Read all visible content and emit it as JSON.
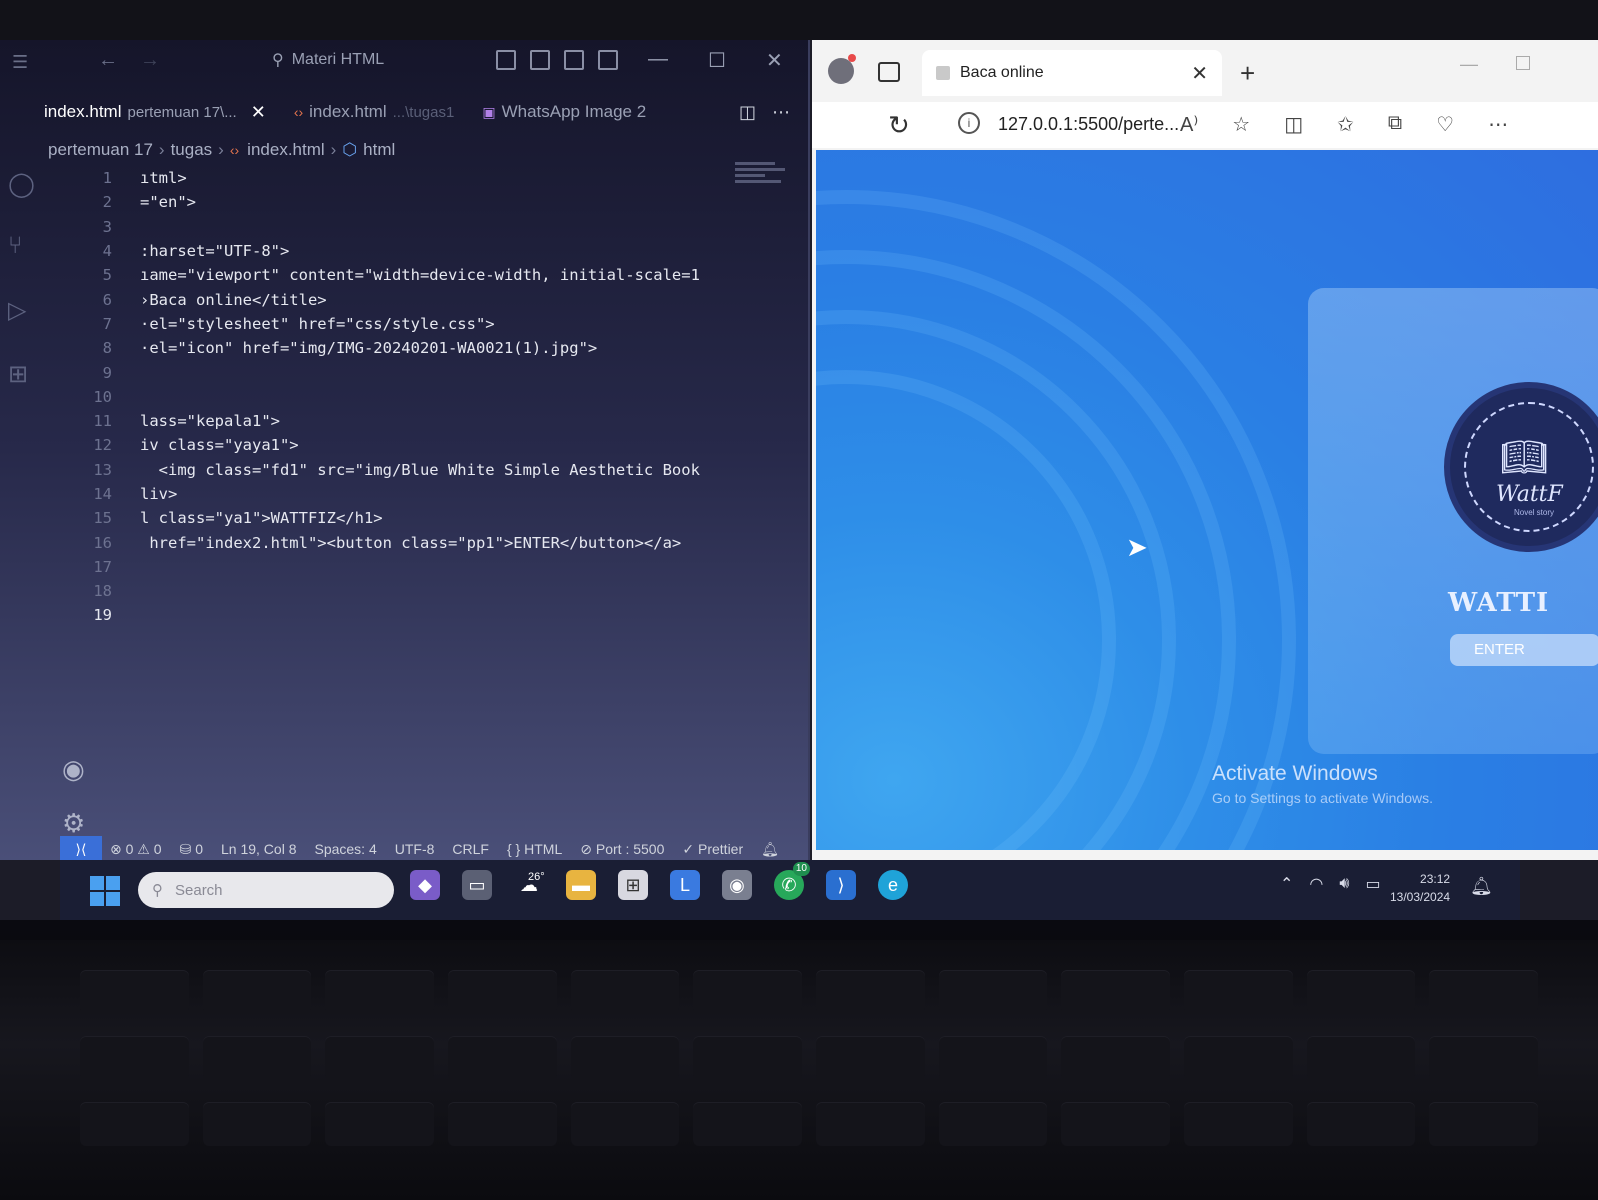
{
  "vscode": {
    "title": "Materi HTML",
    "tabs": [
      {
        "label": "index.html",
        "sublabel": "pertemuan 17\\...",
        "active": true
      },
      {
        "label": "index.html",
        "sublabel": "...\\tugas1",
        "active": false
      },
      {
        "label": "WhatsApp Image 2",
        "sublabel": "",
        "active": false
      }
    ],
    "breadcrumb": [
      "pertemuan 17",
      "tugas",
      "index.html",
      "html"
    ],
    "code_lines": [
      {
        "n": "1",
        "text": "ıtml>"
      },
      {
        "n": "2",
        "text": "=\"en\">"
      },
      {
        "n": "3",
        "text": ""
      },
      {
        "n": "4",
        "text": ":harset=\"UTF-8\">"
      },
      {
        "n": "5",
        "text": "ıame=\"viewport\" content=\"width=device-width, initial-scale=1"
      },
      {
        "n": "6",
        "text": "›Baca online</title>"
      },
      {
        "n": "7",
        "text": "·el=\"stylesheet\" href=\"css/style.css\">"
      },
      {
        "n": "8",
        "text": "·el=\"icon\" href=\"img/IMG-20240201-WA0021(1).jpg\">"
      },
      {
        "n": "9",
        "text": ""
      },
      {
        "n": "10",
        "text": ""
      },
      {
        "n": "11",
        "text": "lass=\"kepala1\">"
      },
      {
        "n": "12",
        "text": "iv class=\"yaya1\">"
      },
      {
        "n": "13",
        "text": "  <img class=\"fd1\" src=\"img/Blue White Simple Aesthetic Book"
      },
      {
        "n": "14",
        "text": "liv>"
      },
      {
        "n": "15",
        "text": "l class=\"ya1\">WATTFIZ</h1>"
      },
      {
        "n": "16",
        "text": " href=\"index2.html\"><button class=\"pp1\">ENTER</button></a>"
      },
      {
        "n": "17",
        "text": ""
      },
      {
        "n": "18",
        "text": ""
      },
      {
        "n": "19",
        "text": ""
      }
    ],
    "status": {
      "errors": "0",
      "warnings": "0",
      "ports": "0",
      "position": "Ln 19, Col 8",
      "spaces": "Spaces: 4",
      "encoding": "UTF-8",
      "eol": "CRLF",
      "language": "HTML",
      "port": "Port : 5500",
      "formatter": "Prettier"
    }
  },
  "browser": {
    "tab_title": "Baca online",
    "url": "127.0.0.1:5500/perte...",
    "page": {
      "logo_text": "WattF",
      "logo_sub": "Novel story",
      "title": "WATTI",
      "button": "ENTER"
    },
    "watermark": {
      "line1": "Activate Windows",
      "line2": "Go to Settings to activate Windows."
    }
  },
  "taskbar": {
    "search_placeholder": "Search",
    "weather_temp": "26°",
    "whatsapp_badge": "10",
    "time": "23:12",
    "date": "13/03/2024"
  }
}
